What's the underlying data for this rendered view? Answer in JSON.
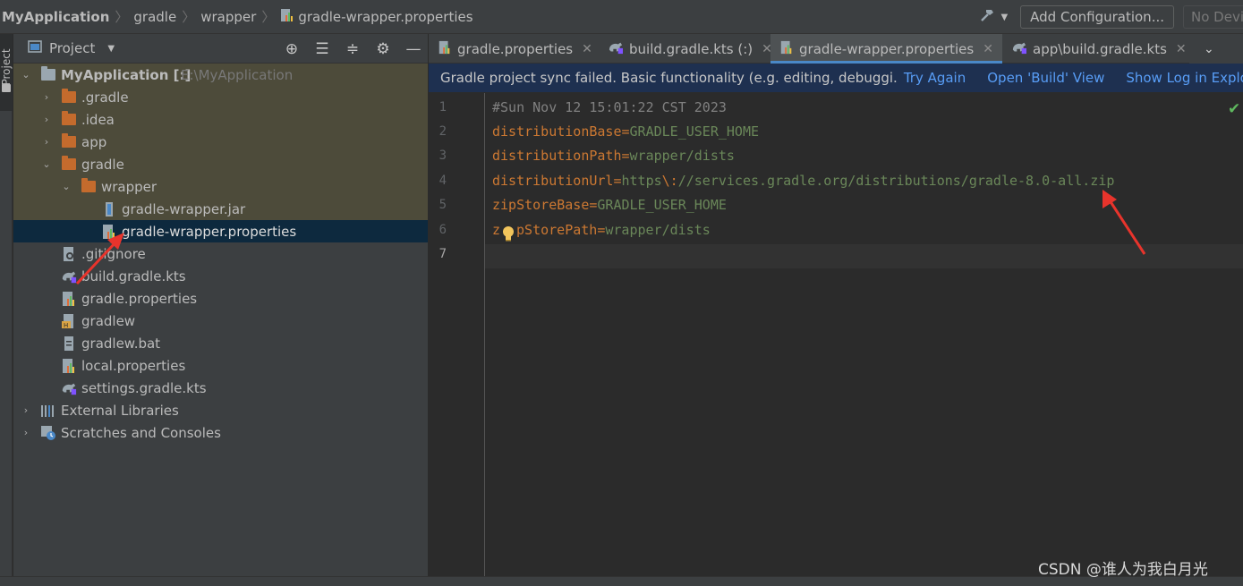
{
  "navbar": {
    "breadcrumbs": [
      "MyApplication",
      "gradle",
      "wrapper",
      "gradle-wrapper.properties"
    ],
    "add_config_label": "Add Configuration...",
    "device_label": "No Devices"
  },
  "toolstrip": {
    "project_label": "Project"
  },
  "project_panel": {
    "title": "Project",
    "tree": [
      {
        "label": "MyApplication [:]",
        "path": "E:\\MyApplication"
      },
      {
        "label": ".gradle"
      },
      {
        "label": ".idea"
      },
      {
        "label": "app"
      },
      {
        "label": "gradle"
      },
      {
        "label": "wrapper"
      },
      {
        "label": "gradle-wrapper.jar"
      },
      {
        "label": "gradle-wrapper.properties"
      },
      {
        "label": ".gitignore"
      },
      {
        "label": "build.gradle.kts"
      },
      {
        "label": "gradle.properties"
      },
      {
        "label": "gradlew"
      },
      {
        "label": "gradlew.bat"
      },
      {
        "label": "local.properties"
      },
      {
        "label": "settings.gradle.kts"
      },
      {
        "label": "External Libraries"
      },
      {
        "label": "Scratches and Consoles"
      }
    ]
  },
  "tabs": [
    {
      "label": "gradle.properties"
    },
    {
      "label": "build.gradle.kts (:)"
    },
    {
      "label": "gradle-wrapper.properties"
    },
    {
      "label": "app\\build.gradle.kts"
    }
  ],
  "banner": {
    "message": "Gradle project sync failed. Basic functionality (e.g. editing, debuggi.",
    "try_again": "Try Again",
    "open_build": "Open 'Build' View",
    "show_log": "Show Log in Explorer"
  },
  "editor": {
    "line_numbers": [
      "1",
      "2",
      "3",
      "4",
      "5",
      "6",
      "7"
    ],
    "lines": [
      {
        "comment": "#Sun Nov 12 15:01:22 CST 2023"
      },
      {
        "key": "distributionBase",
        "eq": "=",
        "value": "GRADLE_USER_HOME"
      },
      {
        "key": "distributionPath",
        "eq": "=",
        "value": "wrapper/dists"
      },
      {
        "key": "distributionUrl",
        "eq": "=",
        "value_a": "https",
        "esc": "\\:",
        "value_b": "//services.gradle.org/distributions/gradle-8.0-all.zip"
      },
      {
        "key": "zipStoreBase",
        "eq": "=",
        "value": "GRADLE_USER_HOME"
      },
      {
        "key_a": "z",
        "key_b": "pStorePath",
        "eq": "=",
        "value": "wrapper/dists"
      }
    ]
  },
  "watermark": "CSDN @谁人为我白月光",
  "colors": {
    "accent": "#4a88c7",
    "annotation_arrow": "#e8342c",
    "folder": "#c46b2d",
    "banner_bg": "#1e3050",
    "link": "#589df6"
  }
}
